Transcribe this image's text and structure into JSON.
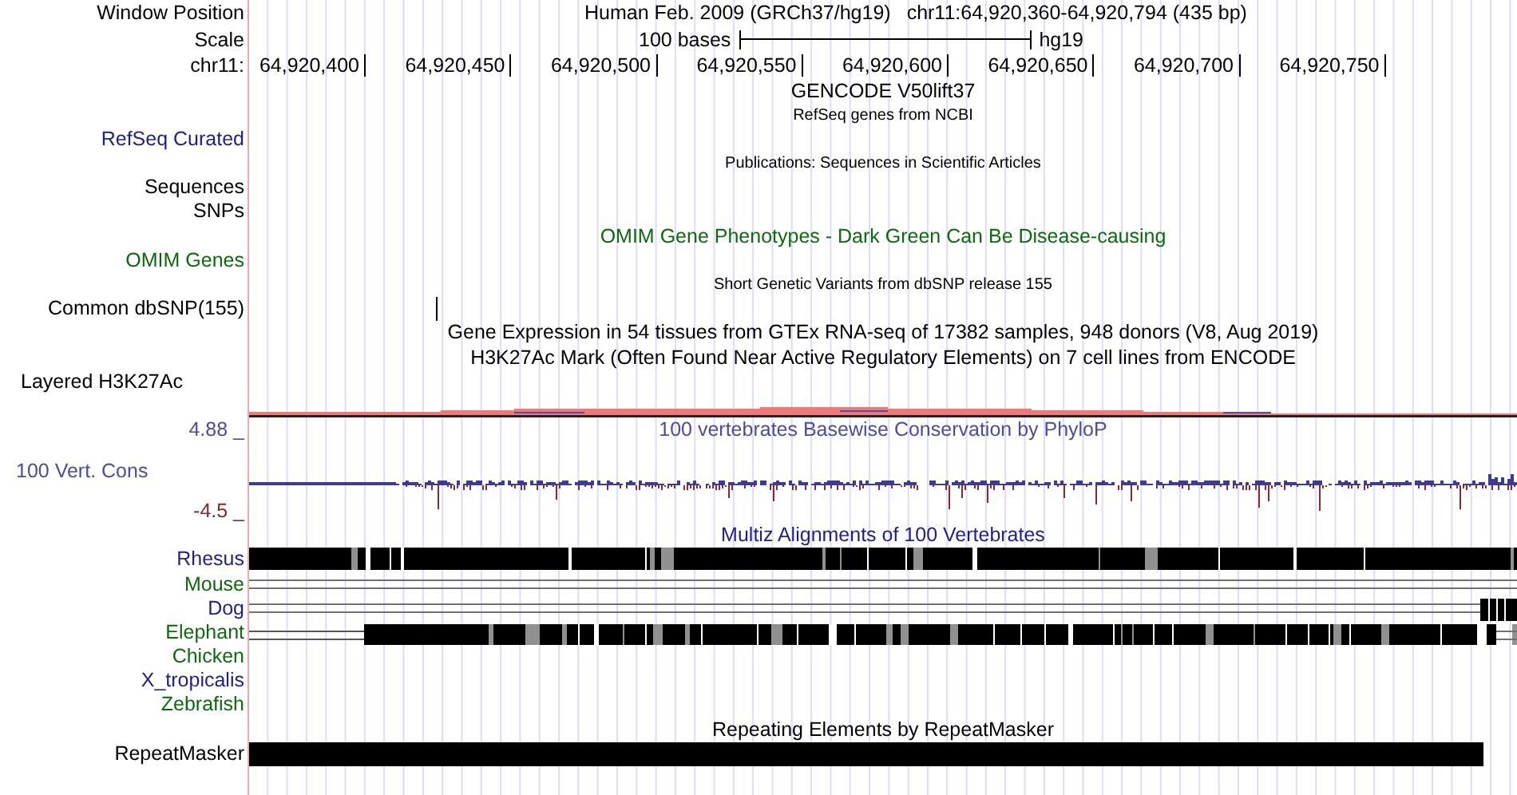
{
  "position": {
    "label": "Window Position",
    "assembly": "Human Feb. 2009 (GRCh37/hg19)",
    "range": "chr11:64,920,360-64,920,794 (435 bp)"
  },
  "scale": {
    "label": "Scale",
    "length": "100 bases",
    "assembly": "hg19"
  },
  "ruler": {
    "label": "chr11:",
    "ticks": [
      "64,920,400",
      "64,920,450",
      "64,920,500",
      "64,920,550",
      "64,920,600",
      "64,920,650",
      "64,920,700",
      "64,920,750"
    ]
  },
  "tracks": [
    {
      "kind": "title",
      "text": "GENCODE V50lift37",
      "color": "#000000"
    },
    {
      "kind": "subtitle",
      "text": "RefSeq genes from NCBI",
      "color": "#000000"
    },
    {
      "kind": "label",
      "label": "RefSeq Curated",
      "color": "#1e1e8c"
    },
    {
      "kind": "subtitle",
      "text": "Publications: Sequences in Scientific Articles",
      "color": "#000000"
    },
    {
      "kind": "label",
      "label": "Sequences",
      "color": "#000000"
    },
    {
      "kind": "label",
      "label": "SNPs",
      "color": "#000000"
    },
    {
      "kind": "title",
      "text": "OMIM Gene Phenotypes - Dark Green Can Be Disease-causing",
      "color": "#0b6a0b"
    },
    {
      "kind": "label",
      "label": "OMIM Genes",
      "color": "#0b6a0b"
    },
    {
      "kind": "subtitle",
      "text": "Short Genetic Variants from dbSNP release 155",
      "color": "#000000"
    },
    {
      "kind": "snp",
      "label": "Common dbSNP(155)",
      "color": "#000000"
    },
    {
      "kind": "title",
      "text": "Gene Expression in 54 tissues from GTEx RNA-seq of 17382 samples, 948 donors (V8, Aug 2019)",
      "color": "#000000"
    },
    {
      "kind": "title",
      "text": "H3K27Ac Mark (Often Found Near Active Regulatory Elements) on 7 cell lines from ENCODE",
      "color": "#000000"
    },
    {
      "kind": "layered",
      "label": "Layered H3K27Ac",
      "color": "#000000"
    },
    {
      "kind": "conservation",
      "max_label": "4.88 _",
      "label": "100 Vert. Cons",
      "min_label": "-4.5 _",
      "text": "100 vertebrates Basewise Conservation by PhyloP",
      "color": "#4b4ba0"
    },
    {
      "kind": "title",
      "text": "Multiz Alignments of 100 Vertebrates",
      "color": "#1e1e8c"
    },
    {
      "kind": "align_full",
      "label": "Rhesus",
      "color": "#1e1e8c"
    },
    {
      "kind": "align_lines",
      "label": "Mouse",
      "color": "#0b6a0b"
    },
    {
      "kind": "align_lines_end",
      "label": "Dog",
      "color": "#1e1e8c"
    },
    {
      "kind": "align_partial",
      "label": "Elephant",
      "color": "#0b6a0b"
    },
    {
      "kind": "align_none",
      "label": "Chicken",
      "color": "#0b6a0b"
    },
    {
      "kind": "align_none",
      "label": "X_tropicalis",
      "color": "#1e1e8c"
    },
    {
      "kind": "align_none",
      "label": "Zebrafish",
      "color": "#0b6a0b"
    },
    {
      "kind": "title",
      "text": "Repeating Elements by RepeatMasker",
      "color": "#000000"
    },
    {
      "kind": "bar",
      "label": "RepeatMasker",
      "color": "#000000"
    }
  ]
}
